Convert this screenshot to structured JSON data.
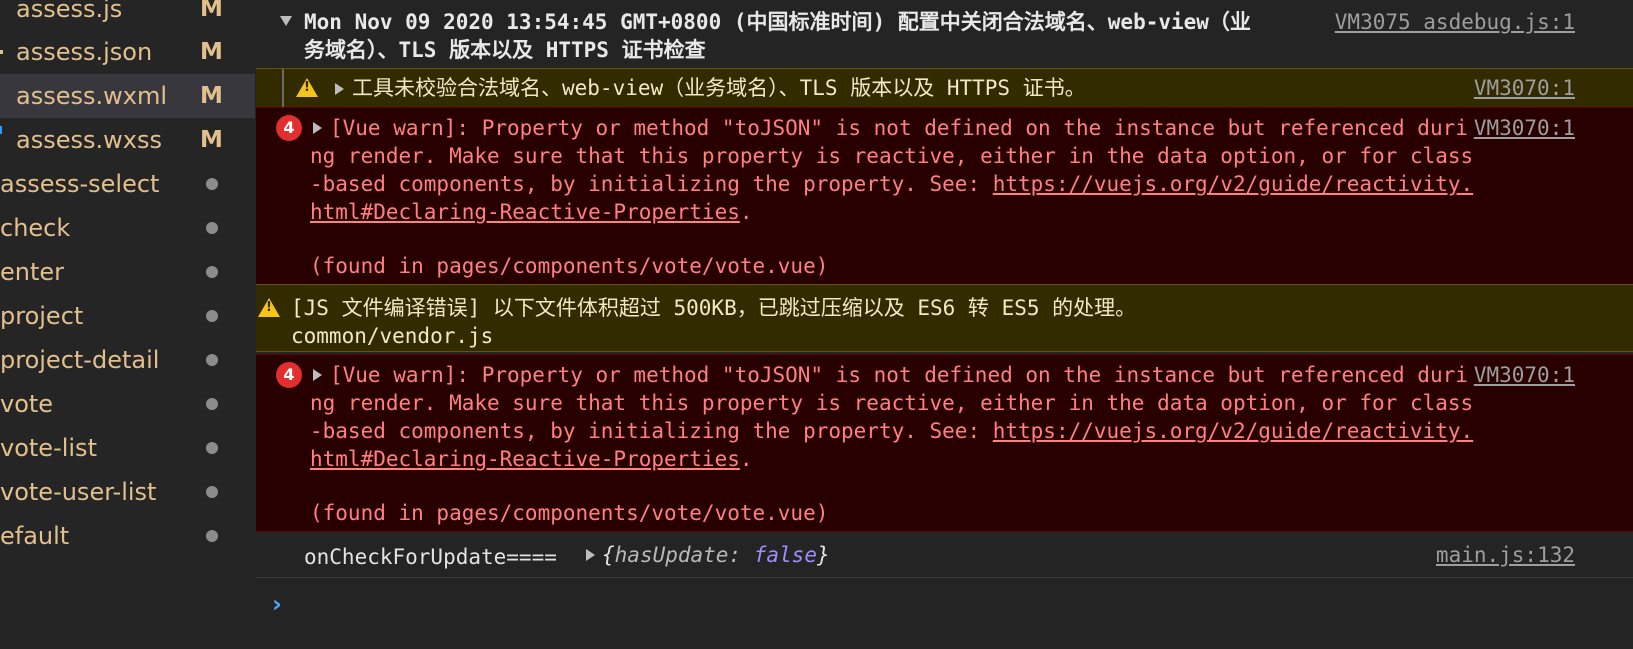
{
  "sidebar": {
    "items": [
      {
        "name": "assess.js",
        "status": "M",
        "color": "#e2c08d"
      },
      {
        "name": "assess.json",
        "status": "M",
        "color": "#e2c08d"
      },
      {
        "name": "assess.wxml",
        "status": "M",
        "color": "#e2c08d"
      },
      {
        "name": "assess.wxss",
        "status": "M",
        "color": "#e2c08d"
      },
      {
        "name": "assess-select",
        "status": "dot",
        "color": "#e2c08d"
      },
      {
        "name": "check",
        "status": "dot",
        "color": "#e2c08d"
      },
      {
        "name": "enter",
        "status": "dot",
        "color": "#e2c08d"
      },
      {
        "name": "project",
        "status": "dot",
        "color": "#e2c08d"
      },
      {
        "name": "project-detail",
        "status": "dot",
        "color": "#e2c08d"
      },
      {
        "name": "vote",
        "status": "dot",
        "color": "#e2c08d"
      },
      {
        "name": "vote-list",
        "status": "dot",
        "color": "#e2c08d"
      },
      {
        "name": "vote-user-list",
        "status": "dot",
        "color": "#e2c08d"
      },
      {
        "name": "efault",
        "status": "dot",
        "color": "#e2c08d"
      }
    ],
    "selected_index": 2
  },
  "console": {
    "group": {
      "text": "Mon Nov 09 2020 13:54:45 GMT+0800 (中国标准时间) 配置中关闭合法域名、web-view（业务域名）、TLS 版本以及 HTTPS 证书检查",
      "source": "VM3075 asdebug.js:1"
    },
    "warn1": {
      "text": "工具未校验合法域名、web-view（业务域名）、TLS 版本以及 HTTPS 证书。",
      "source": "VM3070:1"
    },
    "err1": {
      "count": "4",
      "text_before_link": "[Vue warn]: Property or method \"toJSON\" is not defined on the instance but referenced during render. Make sure that this property is reactive, either in the data option, or for class-based components, by initializing the property. See: ",
      "link": "https://vuejs.org/v2/guide/reactivity.html#Declaring-Reactive-Properties",
      "after_link": ".",
      "found": "(found in pages/components/vote/vote.vue)",
      "source": "VM3070:1"
    },
    "warn2": {
      "line1": "[JS 文件编译错误] 以下文件体积超过 500KB，已跳过压缩以及 ES6 转 ES5 的处理。",
      "line2": "common/vendor.js"
    },
    "err2": {
      "count": "4",
      "text_before_link": "[Vue warn]: Property or method \"toJSON\" is not defined on the instance but referenced during render. Make sure that this property is reactive, either in the data option, or for class-based components, by initializing the property. See: ",
      "link": "https://vuejs.org/v2/guide/reactivity.html#Declaring-Reactive-Properties",
      "after_link": ".",
      "found": "(found in pages/components/vote/vote.vue)",
      "source": "VM3070:1"
    },
    "log": {
      "label": "onCheckForUpdate====",
      "obj_open": "{",
      "obj_key": "hasUpdate:",
      "obj_value": "false",
      "obj_close": "}",
      "source": "main.js:132"
    },
    "prompt": "›"
  }
}
